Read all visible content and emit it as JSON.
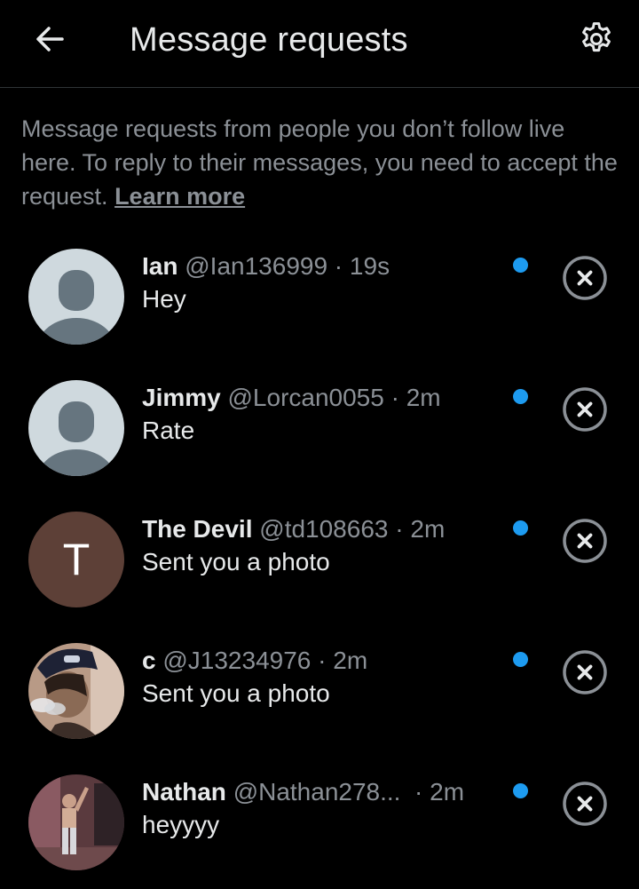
{
  "header": {
    "title": "Message requests",
    "back_icon": "arrow-left-icon",
    "settings_icon": "gear-icon"
  },
  "description": {
    "text": "Message requests from people you don’t follow live here. To reply to their messages, you need to accept the request. ",
    "link_label": "Learn more"
  },
  "requests": [
    {
      "name": "Ian",
      "handle": "@Ian136999",
      "sep": " · ",
      "time": "19s",
      "preview": "Hey",
      "avatar": "default-avatar",
      "unread": true
    },
    {
      "name": "Jimmy",
      "handle": "@Lorcan0055",
      "sep": " · ",
      "time": "2m",
      "preview": "Rate",
      "avatar": "default-avatar",
      "unread": true
    },
    {
      "name": "The Devil",
      "handle": "@td108663",
      "sep": " · ",
      "time": "2m",
      "preview": "Sent you a photo",
      "avatar": "letter-avatar",
      "avatar_letter": "T",
      "unread": true
    },
    {
      "name": "c",
      "handle": "@J13234976",
      "sep": " · ",
      "time": "2m",
      "preview": "Sent you a photo",
      "avatar": "photo-avatar",
      "unread": true
    },
    {
      "name": "Nathan",
      "handle": "@Nathan278...",
      "sep": "  · ",
      "time": "2m",
      "preview": "heyyyy",
      "avatar": "photo-avatar",
      "unread": true
    }
  ],
  "colors": {
    "background": "#000000",
    "primary_text": "#e7e9ea",
    "secondary_text": "#8b9096",
    "unread_dot": "#1d9bf0",
    "divider": "#2f3336"
  }
}
